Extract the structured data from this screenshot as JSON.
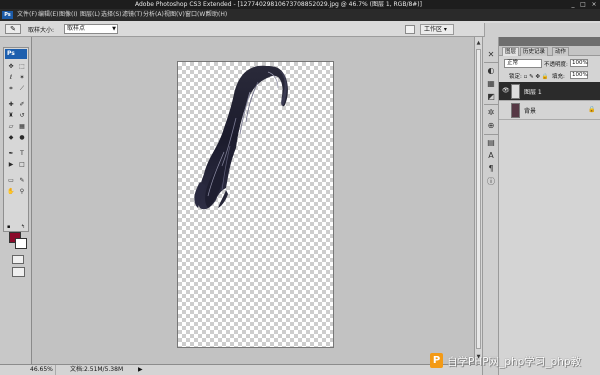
{
  "window": {
    "title": "Adobe Photoshop CS3 Extended - [12774029810673708852029.jpg @ 46.7% (图层 1, RGB/8#)]",
    "controls": [
      "_",
      "□",
      "×"
    ]
  },
  "menubar": {
    "logo": "Ps",
    "items": [
      "文件(F)",
      "编辑(E)",
      "图像(I)",
      "图层(L)",
      "选择(S)",
      "滤镜(T)",
      "分析(A)",
      "视图(V)",
      "窗口(W)",
      "帮助(H)"
    ]
  },
  "options": {
    "tool_icon": "eyedropper-icon",
    "sample_size_label": "取样大小:",
    "sample_size_value": "取样点",
    "workspace_label": "工作区 ▾"
  },
  "toolbox": {
    "logo": "Ps",
    "tools": [
      "move",
      "marquee",
      "lasso",
      "magic-wand",
      "crop",
      "slice",
      "healing",
      "brush",
      "clone-stamp",
      "history-brush",
      "eraser",
      "gradient",
      "blur",
      "dodge",
      "pen",
      "type",
      "path-selection",
      "shape",
      "notes",
      "eyedropper",
      "hand",
      "zoom"
    ],
    "foreground_color": "#8a0a2a",
    "background_color": "#ffffff"
  },
  "layers_panel": {
    "tabs": [
      "图层",
      "历史记录",
      "动作"
    ],
    "blend_mode": "正常",
    "opacity_label": "不透明度:",
    "opacity_value": "100%",
    "lock_label": "锁定:",
    "fill_label": "填充:",
    "fill_value": "100%",
    "layers": [
      {
        "name": "图层 1",
        "selected": true,
        "visible": true,
        "locked": false
      },
      {
        "name": "背景",
        "selected": false,
        "visible": false,
        "locked": true
      }
    ]
  },
  "status": {
    "zoom": "46.65%",
    "doc_size": "文档:2.51M/5.38M"
  },
  "watermark": {
    "text": "自学PHP网_php学习_php教"
  }
}
